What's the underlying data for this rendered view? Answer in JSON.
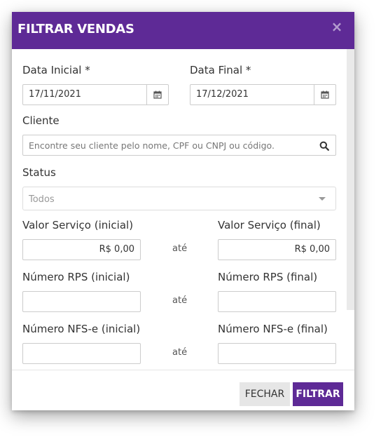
{
  "modal": {
    "title": "FILTRAR VENDAS",
    "close_glyph": "×"
  },
  "fields": {
    "data_inicial": {
      "label": "Data Inicial *",
      "value": "17/11/2021",
      "icon": "calendar-icon"
    },
    "data_final": {
      "label": "Data Final *",
      "value": "17/12/2021",
      "icon": "calendar-icon"
    },
    "cliente": {
      "label": "Cliente",
      "placeholder": "Encontre seu cliente pelo nome, CPF ou CNPJ ou código.",
      "icon": "search-icon"
    },
    "status": {
      "label": "Status",
      "selected": "Todos"
    },
    "valor_servico_inicial": {
      "label": "Valor Serviço (inicial)",
      "value": "R$ 0,00"
    },
    "valor_servico_final": {
      "label": "Valor Serviço (final)",
      "value": "R$ 0,00"
    },
    "numero_rps_inicial": {
      "label": "Número RPS (inicial)",
      "value": ""
    },
    "numero_rps_final": {
      "label": "Número RPS (final)",
      "value": ""
    },
    "numero_nfse_inicial": {
      "label": "Número NFS-e (inicial)",
      "value": ""
    },
    "numero_nfse_final": {
      "label": "Número NFS-e (final)",
      "value": ""
    }
  },
  "range_separator": "até",
  "footer": {
    "close_label": "FECHAR",
    "filter_label": "FILTRAR"
  },
  "colors": {
    "brand": "#5e2a96",
    "secondary_button": "#e6e6e6"
  }
}
